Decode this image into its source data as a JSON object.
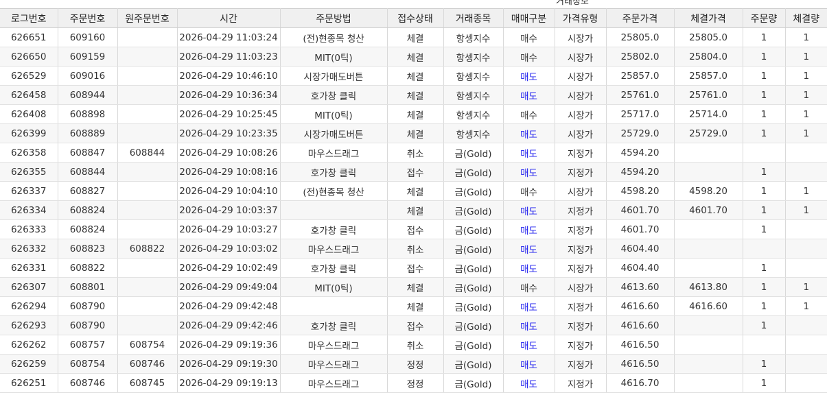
{
  "top_label_partial": "거래정보",
  "columns": [
    "로그번호",
    "주문번호",
    "원주문번호",
    "시간",
    "주문방법",
    "접수상태",
    "거래종목",
    "매매구분",
    "가격유형",
    "주문가격",
    "체결가격",
    "주문량",
    "체결량"
  ],
  "colors": {
    "sell_text": "#1a1aee",
    "header_bg": "#f0f0f0",
    "alt_row_bg": "#f7f7f7"
  },
  "rows": [
    [
      "626651",
      "609160",
      "",
      "2026-04-29 11:03:24",
      "(전)현종목 청산",
      "체결",
      "항셍지수",
      "매수",
      "시장가",
      "25805.0",
      "25805.0",
      "1",
      "1"
    ],
    [
      "626650",
      "609159",
      "",
      "2026-04-29 11:03:23",
      "MIT(0틱)",
      "체결",
      "항셍지수",
      "매수",
      "시장가",
      "25802.0",
      "25804.0",
      "1",
      "1"
    ],
    [
      "626529",
      "609016",
      "",
      "2026-04-29 10:46:10",
      "시장가매도버튼",
      "체결",
      "항셍지수",
      "매도",
      "시장가",
      "25857.0",
      "25857.0",
      "1",
      "1"
    ],
    [
      "626458",
      "608944",
      "",
      "2026-04-29 10:36:34",
      "호가창 클릭",
      "체결",
      "항셍지수",
      "매도",
      "시장가",
      "25761.0",
      "25761.0",
      "1",
      "1"
    ],
    [
      "626408",
      "608898",
      "",
      "2026-04-29 10:25:45",
      "MIT(0틱)",
      "체결",
      "항셍지수",
      "매수",
      "시장가",
      "25717.0",
      "25714.0",
      "1",
      "1"
    ],
    [
      "626399",
      "608889",
      "",
      "2026-04-29 10:23:35",
      "시장가매도버튼",
      "체결",
      "항셍지수",
      "매도",
      "시장가",
      "25729.0",
      "25729.0",
      "1",
      "1"
    ],
    [
      "626358",
      "608847",
      "608844",
      "2026-04-29 10:08:26",
      "마우스드래그",
      "취소",
      "금(Gold)",
      "매도",
      "지정가",
      "4594.20",
      "",
      "",
      ""
    ],
    [
      "626355",
      "608844",
      "",
      "2026-04-29 10:08:16",
      "호가창 클릭",
      "접수",
      "금(Gold)",
      "매도",
      "지정가",
      "4594.20",
      "",
      "1",
      ""
    ],
    [
      "626337",
      "608827",
      "",
      "2026-04-29 10:04:10",
      "(전)현종목 청산",
      "체결",
      "금(Gold)",
      "매수",
      "시장가",
      "4598.20",
      "4598.20",
      "1",
      "1"
    ],
    [
      "626334",
      "608824",
      "",
      "2026-04-29 10:03:37",
      "",
      "체결",
      "금(Gold)",
      "매도",
      "지정가",
      "4601.70",
      "4601.70",
      "1",
      "1"
    ],
    [
      "626333",
      "608824",
      "",
      "2026-04-29 10:03:27",
      "호가창 클릭",
      "접수",
      "금(Gold)",
      "매도",
      "지정가",
      "4601.70",
      "",
      "1",
      ""
    ],
    [
      "626332",
      "608823",
      "608822",
      "2026-04-29 10:03:02",
      "마우스드래그",
      "취소",
      "금(Gold)",
      "매도",
      "지정가",
      "4604.40",
      "",
      "",
      ""
    ],
    [
      "626331",
      "608822",
      "",
      "2026-04-29 10:02:49",
      "호가창 클릭",
      "접수",
      "금(Gold)",
      "매도",
      "지정가",
      "4604.40",
      "",
      "1",
      ""
    ],
    [
      "626307",
      "608801",
      "",
      "2026-04-29 09:49:04",
      "MIT(0틱)",
      "체결",
      "금(Gold)",
      "매수",
      "시장가",
      "4613.60",
      "4613.80",
      "1",
      "1"
    ],
    [
      "626294",
      "608790",
      "",
      "2026-04-29 09:42:48",
      "",
      "체결",
      "금(Gold)",
      "매도",
      "지정가",
      "4616.60",
      "4616.60",
      "1",
      "1"
    ],
    [
      "626293",
      "608790",
      "",
      "2026-04-29 09:42:46",
      "호가창 클릭",
      "접수",
      "금(Gold)",
      "매도",
      "지정가",
      "4616.60",
      "",
      "1",
      ""
    ],
    [
      "626262",
      "608757",
      "608754",
      "2026-04-29 09:19:36",
      "마우스드래그",
      "취소",
      "금(Gold)",
      "매도",
      "지정가",
      "4616.50",
      "",
      "",
      ""
    ],
    [
      "626259",
      "608754",
      "608746",
      "2026-04-29 09:19:30",
      "마우스드래그",
      "정정",
      "금(Gold)",
      "매도",
      "지정가",
      "4616.50",
      "",
      "1",
      ""
    ],
    [
      "626251",
      "608746",
      "608745",
      "2026-04-29 09:19:13",
      "마우스드래그",
      "정정",
      "금(Gold)",
      "매도",
      "지정가",
      "4616.70",
      "",
      "1",
      ""
    ]
  ]
}
